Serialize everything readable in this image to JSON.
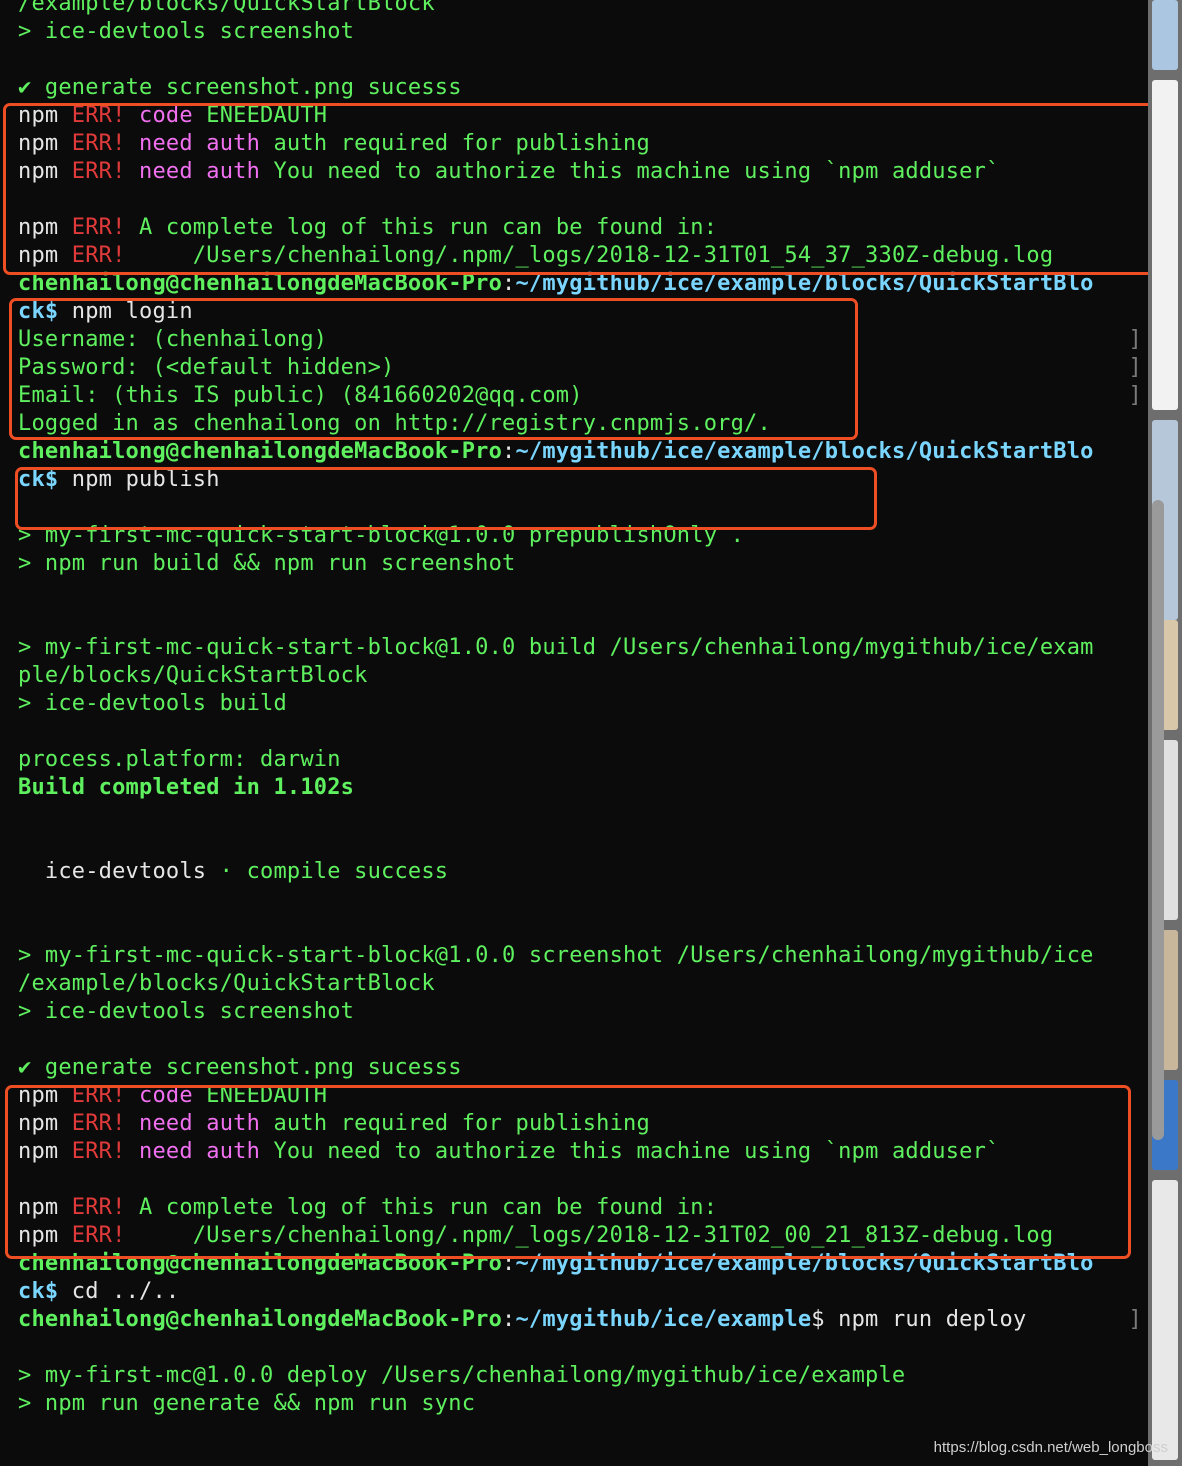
{
  "terminal": {
    "watermark": "https://blog.csdn.net/web_longboss",
    "prompt_user": "chenhailong@chenhailongdeMacBook-Pro",
    "prompt_path_blocks": "~/mygithub/ice/example/blocks/QuickStartBlo",
    "prompt_path_example": "~/mygithub/ice/example",
    "lines": [
      {
        "kind": "plain",
        "text": "/example/blocks/QuickStartBlock"
      },
      {
        "kind": "plain",
        "text": "> ice-devtools screenshot"
      },
      {
        "kind": "blank"
      },
      {
        "kind": "check",
        "text": "generate screenshot.png sucesss"
      },
      {
        "kind": "err",
        "a": "code",
        "b": "ENEEDAUTH"
      },
      {
        "kind": "err",
        "a": "need",
        "b": "auth",
        "c": "auth required for publishing"
      },
      {
        "kind": "err",
        "a": "need",
        "b": "auth",
        "c": "You need to authorize this machine using `npm adduser`"
      },
      {
        "kind": "blank"
      },
      {
        "kind": "errplain",
        "c": "A complete log of this run can be found in:"
      },
      {
        "kind": "errplain",
        "c": "    /Users/chenhailong/.npm/_logs/2018-12-31T01_54_37_330Z-debug.log"
      },
      {
        "kind": "prompt",
        "path": "blocks"
      },
      {
        "kind": "cmd",
        "cont": "ck$",
        "text": " npm login"
      },
      {
        "kind": "plain",
        "text": "Username: (chenhailong)",
        "bracket": true
      },
      {
        "kind": "plain",
        "text": "Password: (<default hidden>)",
        "bracket": true
      },
      {
        "kind": "plain",
        "text": "Email: (this IS public) (841660202@qq.com)",
        "bracket": true
      },
      {
        "kind": "plain",
        "text": "Logged in as chenhailong on http://registry.cnpmjs.org/."
      },
      {
        "kind": "prompt",
        "path": "blocks"
      },
      {
        "kind": "cmd",
        "cont": "ck$",
        "text": " npm publish"
      },
      {
        "kind": "blank"
      },
      {
        "kind": "plain",
        "text": "> my-first-mc-quick-start-block@1.0.0 prepublishOnly ."
      },
      {
        "kind": "plain",
        "text": "> npm run build && npm run screenshot"
      },
      {
        "kind": "blank"
      },
      {
        "kind": "blank"
      },
      {
        "kind": "plain",
        "text": "> my-first-mc-quick-start-block@1.0.0 build /Users/chenhailong/mygithub/ice/exam"
      },
      {
        "kind": "plain",
        "text": "ple/blocks/QuickStartBlock"
      },
      {
        "kind": "plain",
        "text": "> ice-devtools build"
      },
      {
        "kind": "blank"
      },
      {
        "kind": "plain",
        "text": "process.platform: darwin"
      },
      {
        "kind": "bold",
        "text": "Build completed in 1.102s"
      },
      {
        "kind": "blank"
      },
      {
        "kind": "blank"
      },
      {
        "kind": "compile",
        "a": "  ice-devtools",
        "b": " · ",
        "c": "compile success"
      },
      {
        "kind": "blank"
      },
      {
        "kind": "blank"
      },
      {
        "kind": "plain",
        "text": "> my-first-mc-quick-start-block@1.0.0 screenshot /Users/chenhailong/mygithub/ice"
      },
      {
        "kind": "plain",
        "text": "/example/blocks/QuickStartBlock"
      },
      {
        "kind": "plain",
        "text": "> ice-devtools screenshot"
      },
      {
        "kind": "blank"
      },
      {
        "kind": "check",
        "text": "generate screenshot.png sucesss"
      },
      {
        "kind": "err",
        "a": "code",
        "b": "ENEEDAUTH"
      },
      {
        "kind": "err",
        "a": "need",
        "b": "auth",
        "c": "auth required for publishing"
      },
      {
        "kind": "err",
        "a": "need",
        "b": "auth",
        "c": "You need to authorize this machine using `npm adduser`"
      },
      {
        "kind": "blank"
      },
      {
        "kind": "errplain",
        "c": "A complete log of this run can be found in:"
      },
      {
        "kind": "errplain",
        "c": "    /Users/chenhailong/.npm/_logs/2018-12-31T02_00_21_813Z-debug.log"
      },
      {
        "kind": "prompt",
        "path": "blocks"
      },
      {
        "kind": "cmd",
        "cont": "ck$",
        "text": " cd ../.."
      },
      {
        "kind": "prompt",
        "path": "example",
        "tail": "$ npm run deploy",
        "bracket": true
      },
      {
        "kind": "blank"
      },
      {
        "kind": "plain",
        "text": "> my-first-mc@1.0.0 deploy /Users/chenhailong/mygithub/ice/example"
      },
      {
        "kind": "plain",
        "text": "> npm run generate && npm run sync"
      }
    ]
  },
  "tokens": {
    "npm": "npm",
    "err": "ERR!",
    "check": "✔"
  },
  "colors": {
    "text_green": "#5ff05f",
    "text_white": "#e6e6e6",
    "err_red": "#e03a3a",
    "magenta": "#f070f0",
    "cyan": "#7ad6ff",
    "highlight_box": "#ee4e24"
  }
}
